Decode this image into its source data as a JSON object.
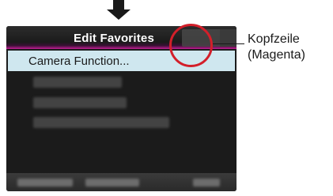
{
  "screen": {
    "title": "Edit Favorites",
    "selected_item": "Camera Function...",
    "blurred_items_count": 3,
    "footer_blurred": true
  },
  "callout": {
    "line1": "Kopfzeile",
    "line2": "(Magenta)",
    "highlight_color": "#d31f2a",
    "header_accent_color": "#c21f94"
  },
  "arrow": {
    "direction": "down",
    "icon": "down-arrow-icon"
  }
}
